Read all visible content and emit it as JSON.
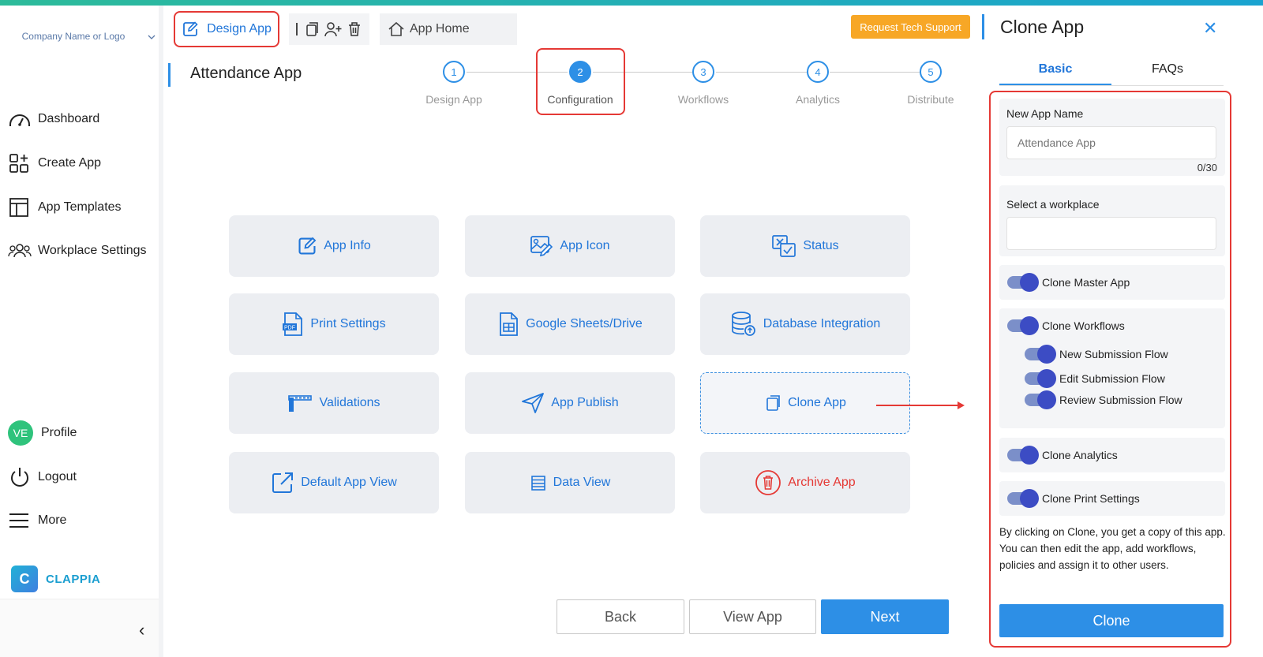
{
  "sidebar": {
    "company": "Company Name or Logo",
    "items": [
      {
        "label": "Dashboard",
        "icon": "dashboard-icon"
      },
      {
        "label": "Create App",
        "icon": "create-app-icon"
      },
      {
        "label": "App Templates",
        "icon": "templates-icon"
      },
      {
        "label": "Workplace Settings",
        "icon": "users-icon"
      }
    ],
    "profile": {
      "initials": "VE",
      "label": "Profile"
    },
    "logout": "Logout",
    "more": "More",
    "brand": "CLAPPIA",
    "collapse": "‹"
  },
  "header": {
    "design_app": "Design App",
    "app_home": "App Home",
    "tech_support": "Request Tech Support",
    "page_title": "Attendance App"
  },
  "stepper": [
    {
      "num": "1",
      "label": "Design App"
    },
    {
      "num": "2",
      "label": "Configuration",
      "active": true
    },
    {
      "num": "3",
      "label": "Workflows"
    },
    {
      "num": "4",
      "label": "Analytics"
    },
    {
      "num": "5",
      "label": "Distribute"
    }
  ],
  "tiles": [
    {
      "label": "App Info",
      "icon": "edit-icon"
    },
    {
      "label": "App Icon",
      "icon": "image-icon"
    },
    {
      "label": "Status",
      "icon": "status-icon"
    },
    {
      "label": "Print Settings",
      "icon": "pdf-icon"
    },
    {
      "label": "Google Sheets/Drive",
      "icon": "sheet-icon"
    },
    {
      "label": "Database Integration",
      "icon": "database-icon"
    },
    {
      "label": "Validations",
      "icon": "validation-icon"
    },
    {
      "label": "App Publish",
      "icon": "send-icon"
    },
    {
      "label": "Clone App",
      "icon": "clone-icon"
    },
    {
      "label": "Default App View",
      "icon": "external-link-icon"
    },
    {
      "label": "Data View",
      "icon": "list-icon"
    },
    {
      "label": "Archive App",
      "icon": "trash-icon"
    }
  ],
  "buttons": {
    "back": "Back",
    "view_app": "View App",
    "next": "Next"
  },
  "panel": {
    "title": "Clone App",
    "close": "✕",
    "tabs": [
      "Basic",
      "FAQs"
    ],
    "new_app_name_label": "New App Name",
    "new_app_name_value": "Attendance App",
    "counter": "0/30",
    "workplace_label": "Select a workplace",
    "workplace_value": "",
    "toggles": {
      "master": "Clone Master App",
      "workflows": "Clone Workflows",
      "new_flow": "New Submission Flow",
      "edit_flow": "Edit Submission Flow",
      "review_flow": "Review Submission Flow",
      "analytics": "Clone Analytics",
      "print": "Clone Print Settings"
    },
    "note": "By clicking on Clone, you get a copy of this app. You can then edit the app, add workflows, policies and assign it to other users.",
    "clone_button": "Clone"
  },
  "colors": {
    "accent": "#2d8fe6",
    "highlight": "#e53935",
    "support": "#f7a726"
  }
}
